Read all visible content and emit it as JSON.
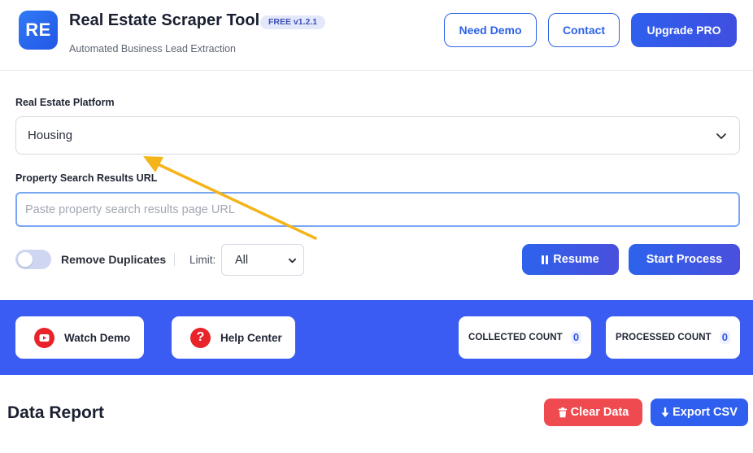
{
  "header": {
    "logo_text": "RE",
    "title": "Real Estate Scraper Tool",
    "version_badge": "FREE v1.2.1",
    "subtitle": "Automated Business Lead Extraction",
    "need_demo_label": "Need Demo",
    "contact_label": "Contact",
    "upgrade_label": "Upgrade PRO",
    "accent_color": "#2c62e8"
  },
  "form": {
    "platform_label": "Real Estate Platform",
    "platform_value": "Housing",
    "url_label": "Property Search Results URL",
    "url_placeholder": "Paste property search results page URL",
    "url_value": "",
    "remove_duplicates_label": "Remove Duplicates",
    "remove_duplicates_on": false,
    "limit_label": "Limit:",
    "limit_value": "All",
    "resume_label": "Resume",
    "start_label": "Start Process"
  },
  "band": {
    "color": "#3a5cf2",
    "watch_demo_label": "Watch Demo",
    "help_center_label": "Help Center",
    "collected_label": "COLLECTED COUNT",
    "collected_value": "0",
    "processed_label": "PROCESSED COUNT",
    "processed_value": "0"
  },
  "report": {
    "title": "Data Report",
    "clear_label": "Clear Data",
    "export_label": "Export CSV"
  },
  "icons": [
    "chevron-down-icon",
    "pause-icon",
    "youtube-icon",
    "help-icon",
    "trash-icon",
    "download-icon",
    "annotation-arrow"
  ]
}
